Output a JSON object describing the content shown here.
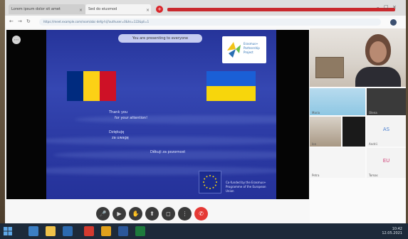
{
  "browser": {
    "tabs": [
      {
        "label": "Lorem ipsum dolor sit amet"
      },
      {
        "label": "Sed do eiusmod"
      }
    ],
    "new_tab_label": "+",
    "url": "https://meet.example.com/room/abc-defg-hij?authuser=0&hs=122&pli=1"
  },
  "slide": {
    "share_banner": "You are presenting to everyone",
    "logo_text": "Erasmus+ Partnership Project",
    "lines": [
      "Thank you",
      "for your attention!",
      "Dziękuję",
      "za uwagę",
      "Děkuji za pozornost"
    ],
    "eu_text": "Co-funded by the Erasmus+ Programme of the European Union"
  },
  "controls": [
    {
      "icon": "mic-icon",
      "glyph": "🎤"
    },
    {
      "icon": "camera-icon",
      "glyph": "▶"
    },
    {
      "icon": "hand-icon",
      "glyph": "✋"
    },
    {
      "icon": "present-icon",
      "glyph": "⬆"
    },
    {
      "icon": "captions-icon",
      "glyph": "◻"
    },
    {
      "icon": "more-icon",
      "glyph": "⋮"
    },
    {
      "icon": "end-call-icon",
      "glyph": "✆"
    }
  ],
  "participants": {
    "tile_labels": [
      "Maria",
      "Olena",
      "Ion",
      "Andrii",
      "Petra",
      "Tomas"
    ],
    "initials": [
      "AS",
      "EU"
    ]
  },
  "taskbar": {
    "time": "10:42",
    "date": "12.05.2021"
  },
  "colors": {
    "slide_blue": "#2d3ca6",
    "ro_blue": "#002b7f",
    "ro_yellow": "#fcd116",
    "ro_red": "#ce1126",
    "ua_blue": "#1a5fd6",
    "ua_yellow": "#f7d60c",
    "end_call": "#e53935"
  }
}
